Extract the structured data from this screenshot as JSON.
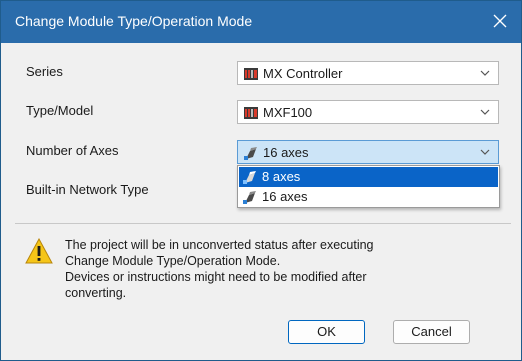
{
  "window": {
    "title": "Change Module Type/Operation Mode"
  },
  "form": {
    "series": {
      "label": "Series",
      "value": "MX Controller",
      "icon": "controller-module-icon"
    },
    "type_model": {
      "label": "Type/Model",
      "value": "MXF100",
      "icon": "controller-module-icon"
    },
    "axes": {
      "label": "Number of Axes",
      "value": "16 axes",
      "icon": "servo-axis-icon",
      "options": [
        {
          "label": "8 axes",
          "selected": true
        },
        {
          "label": "16 axes",
          "selected": false
        }
      ]
    },
    "network": {
      "label": "Built-in Network Type"
    }
  },
  "message": {
    "icon": "warning-icon",
    "lines": [
      "The project will be in unconverted status after executing",
      "Change Module Type/Operation Mode.",
      "Devices or instructions might need to be modified after",
      "converting."
    ]
  },
  "buttons": {
    "ok": "OK",
    "cancel": "Cancel"
  },
  "colors": {
    "title_bar": "#2a6cab",
    "selection": "#0a64c8",
    "focused_combo": "#cce4f7",
    "warning": "#f5c518"
  }
}
